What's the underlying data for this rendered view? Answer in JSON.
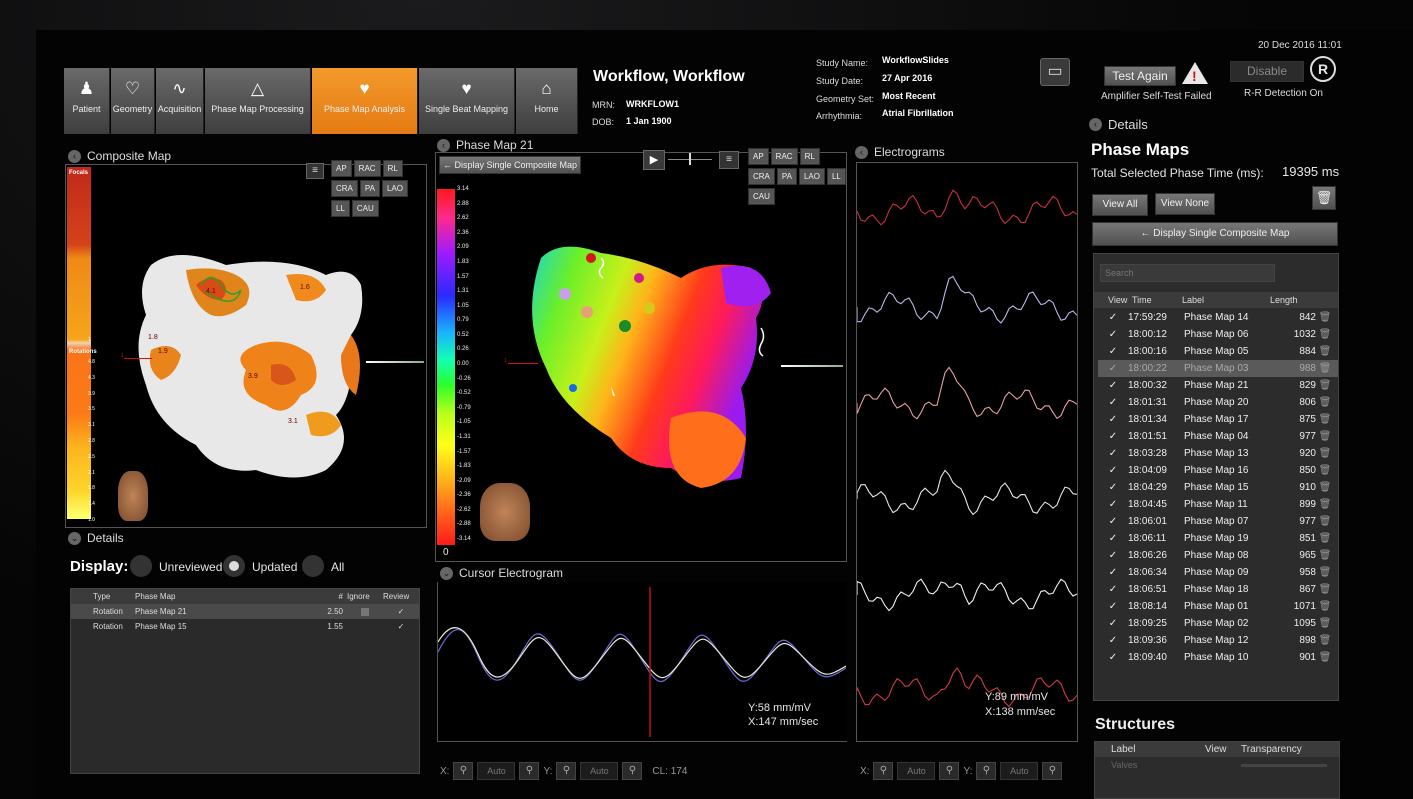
{
  "nav": {
    "tabs": [
      {
        "label": "Patient",
        "icon": "patient-icon"
      },
      {
        "label": "Geometry",
        "icon": "geometry-icon"
      },
      {
        "label": "Acquisition",
        "icon": "acquisition-icon"
      },
      {
        "label": "Phase Map Processing",
        "icon": "processing-icon"
      },
      {
        "label": "Phase Map Analysis",
        "icon": "analysis-icon"
      },
      {
        "label": "Single Beat Mapping",
        "icon": "single-beat-icon"
      },
      {
        "label": "Home",
        "icon": "home-icon"
      }
    ],
    "active_index": 4,
    "accent": "#f08a1c"
  },
  "patient": {
    "name": "Workflow, Workflow",
    "mrn_label": "MRN:",
    "mrn": "WRKFLOW1",
    "dob_label": "DOB:",
    "dob": "1 Jan 1900"
  },
  "study": {
    "name_label": "Study Name:",
    "name": "WorkflowSlides",
    "date_label": "Study Date:",
    "date": "27 Apr 2016",
    "geometry_label": "Geometry Set:",
    "geometry": "Most Recent",
    "arrhythmia_label": "Arrhythmia:",
    "arrhythmia": "Atrial Fibrillation"
  },
  "status": {
    "datetime": "20 Dec 2016 11:01",
    "test_again": "Test Again",
    "amp_msg": "Amplifier Self-Test Failed",
    "disable": "Disable",
    "rr_msg": "R-R Detection On"
  },
  "views": [
    "AP",
    "RAC",
    "RL",
    "CRA",
    "PA",
    "LAO",
    "LL",
    "CAU"
  ],
  "composite": {
    "title": "Composite Map",
    "focals": "Focals",
    "rotations": "Rotations",
    "focal_scale": [
      "1"
    ],
    "rotation_scale": [
      "4.8",
      "4.3",
      "3.9",
      "3.5",
      "3.1",
      "2.8",
      "2.5",
      "2.1",
      "1.8",
      "1.4",
      "1.0"
    ],
    "marks": [
      "4.1",
      "1.6",
      "1.8",
      "1.9",
      "3.9",
      "3.1"
    ],
    "axis_mark": "1"
  },
  "details_left": {
    "title": "Details",
    "display_label": "Display:",
    "options": [
      "Unreviewed",
      "Updated",
      "All"
    ],
    "selected": "Updated",
    "columns": [
      "Type",
      "Phase Map",
      "#",
      "Ignore",
      "Review"
    ],
    "rows": [
      {
        "type": "Rotation",
        "map": "Phase Map 21",
        "num": "2.50"
      },
      {
        "type": "Rotation",
        "map": "Phase Map 15",
        "num": "1.55"
      }
    ]
  },
  "phase_map": {
    "title": "Phase Map 21",
    "back_btn": "Display Single Composite Map",
    "scale": [
      "3.14",
      "2.88",
      "2.62",
      "2.36",
      "2.09",
      "1.83",
      "1.57",
      "1.31",
      "1.05",
      "0.79",
      "0.52",
      "0.26",
      "0.00",
      "-0.26",
      "-0.52",
      "-0.79",
      "-1.05",
      "-1.31",
      "-1.57",
      "-1.83",
      "-2.09",
      "-2.36",
      "-2.62",
      "-2.88",
      "-3.14"
    ],
    "scale_bottom": "0",
    "axis_mark": "1"
  },
  "cursor_egm": {
    "title": "Cursor Electrogram",
    "y": "Y:58 mm/mV",
    "x": "X:147 mm/sec",
    "cl": "CL: 174",
    "x_label": "X:",
    "y_label": "Y:",
    "auto": "Auto"
  },
  "electrograms": {
    "title": "Electrograms",
    "y": "Y:89 mm/mV",
    "x": "X:138 mm/sec",
    "trace_colors": [
      "#c8303a",
      "#b8b8e8",
      "#e8a0a0",
      "#e6e6e6",
      "#f0f0f0",
      "#d03a48"
    ]
  },
  "details_right": {
    "title": "Details",
    "heading": "Phase Maps",
    "total_label": "Total Selected Phase Time (ms):",
    "total_value": "19395 ms",
    "view_all": "View All",
    "view_none": "View None",
    "display_btn": "Display Single Composite Map",
    "search_placeholder": "Search",
    "columns": [
      "View",
      "Time",
      "Label",
      "Length"
    ],
    "rows": [
      {
        "time": "17:59:29",
        "label": "Phase Map 14",
        "length": "842"
      },
      {
        "time": "18:00:12",
        "label": "Phase Map 06",
        "length": "1032"
      },
      {
        "time": "18:00:16",
        "label": "Phase Map 05",
        "length": "884"
      },
      {
        "time": "18:00:22",
        "label": "Phase Map 03",
        "length": "988"
      },
      {
        "time": "18:00:32",
        "label": "Phase Map 21",
        "length": "829"
      },
      {
        "time": "18:01:31",
        "label": "Phase Map 20",
        "length": "806"
      },
      {
        "time": "18:01:34",
        "label": "Phase Map 17",
        "length": "875"
      },
      {
        "time": "18:01:51",
        "label": "Phase Map 04",
        "length": "977"
      },
      {
        "time": "18:03:28",
        "label": "Phase Map 13",
        "length": "920"
      },
      {
        "time": "18:04:09",
        "label": "Phase Map 16",
        "length": "850"
      },
      {
        "time": "18:04:29",
        "label": "Phase Map 15",
        "length": "910"
      },
      {
        "time": "18:04:45",
        "label": "Phase Map 11",
        "length": "899"
      },
      {
        "time": "18:06:01",
        "label": "Phase Map 07",
        "length": "977"
      },
      {
        "time": "18:06:11",
        "label": "Phase Map 19",
        "length": "851"
      },
      {
        "time": "18:06:26",
        "label": "Phase Map 08",
        "length": "965"
      },
      {
        "time": "18:06:34",
        "label": "Phase Map 09",
        "length": "958"
      },
      {
        "time": "18:06:51",
        "label": "Phase Map 18",
        "length": "867"
      },
      {
        "time": "18:08:14",
        "label": "Phase Map 01",
        "length": "1071"
      },
      {
        "time": "18:09:25",
        "label": "Phase Map 02",
        "length": "1095"
      },
      {
        "time": "18:09:36",
        "label": "Phase Map 12",
        "length": "898"
      },
      {
        "time": "18:09:40",
        "label": "Phase Map 10",
        "length": "901"
      }
    ],
    "selected_index": 3
  },
  "structures": {
    "title": "Structures",
    "columns": [
      "Label",
      "View",
      "Transparency"
    ],
    "rows": [
      {
        "label": "Valves"
      }
    ]
  }
}
